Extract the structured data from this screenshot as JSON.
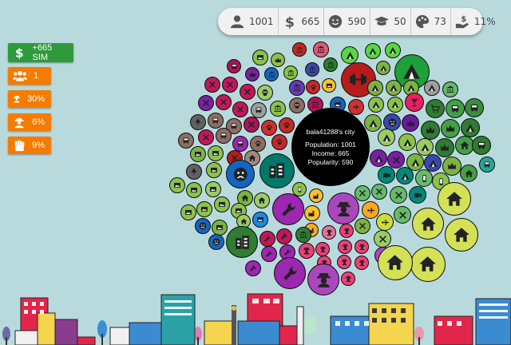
{
  "stats": [
    {
      "icon": "person-icon",
      "value": "1001"
    },
    {
      "icon": "dollar-icon",
      "value": "665"
    },
    {
      "icon": "smiley-icon",
      "value": "590"
    },
    {
      "icon": "graduation-cap-icon",
      "value": "50"
    },
    {
      "icon": "palette-icon",
      "value": "73"
    },
    {
      "icon": "hand-money-icon",
      "value": "11%"
    }
  ],
  "side": {
    "sim_label": "+665 SIM",
    "people_value": "1",
    "thief_value": "30%",
    "worker_value": "6%",
    "fist_value": "9%"
  },
  "city": {
    "name": "bala41288's city",
    "population": "Population: 1001",
    "income": "Income: 665",
    "popularity": "Popularity: 590"
  },
  "colors": {
    "background": "#b9dadd",
    "sim_button": "#2e9a3b",
    "orange_button": "#f57c00",
    "center": "#000000"
  }
}
